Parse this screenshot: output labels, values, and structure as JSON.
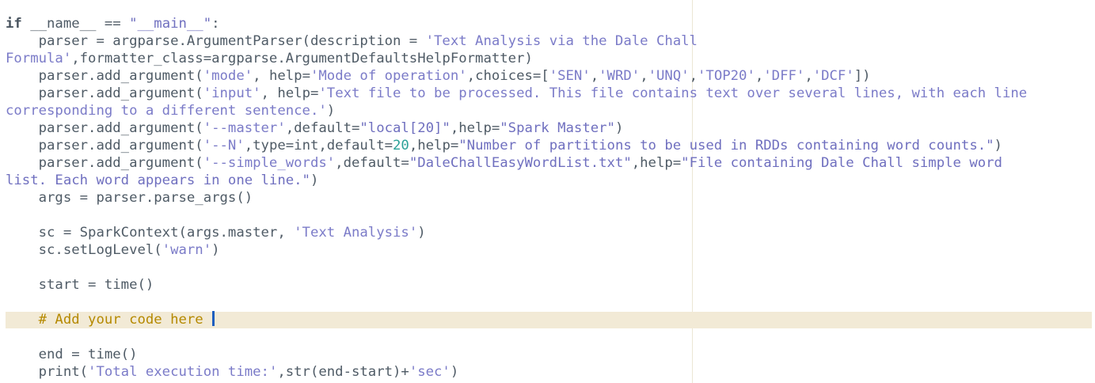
{
  "editor": {
    "lines": [
      [
        {
          "t": "if",
          "c": "kw"
        },
        {
          "t": " __name__ == ",
          "c": ""
        },
        {
          "t": "\"__main__\"",
          "c": "dstr"
        },
        {
          "t": ":",
          "c": ""
        }
      ],
      [
        {
          "t": "    parser = argparse.ArgumentParser(description = ",
          "c": ""
        },
        {
          "t": "'Text Analysis via the Dale Chall",
          "c": "str"
        }
      ],
      [
        {
          "t": "Formula'",
          "c": "str"
        },
        {
          "t": ",formatter_class=argparse.ArgumentDefaultsHelpFormatter)",
          "c": ""
        }
      ],
      [
        {
          "t": "    parser.add_argument(",
          "c": ""
        },
        {
          "t": "'mode'",
          "c": "str"
        },
        {
          "t": ", help=",
          "c": ""
        },
        {
          "t": "'Mode of operation'",
          "c": "str"
        },
        {
          "t": ",choices=[",
          "c": ""
        },
        {
          "t": "'SEN'",
          "c": "str"
        },
        {
          "t": ",",
          "c": ""
        },
        {
          "t": "'WRD'",
          "c": "str"
        },
        {
          "t": ",",
          "c": ""
        },
        {
          "t": "'UNQ'",
          "c": "str"
        },
        {
          "t": ",",
          "c": ""
        },
        {
          "t": "'TOP20'",
          "c": "str"
        },
        {
          "t": ",",
          "c": ""
        },
        {
          "t": "'DFF'",
          "c": "str"
        },
        {
          "t": ",",
          "c": ""
        },
        {
          "t": "'DCF'",
          "c": "str"
        },
        {
          "t": "])",
          "c": ""
        }
      ],
      [
        {
          "t": "    parser.add_argument(",
          "c": ""
        },
        {
          "t": "'input'",
          "c": "str"
        },
        {
          "t": ", help=",
          "c": ""
        },
        {
          "t": "'Text file to be processed. This file contains text over several lines, with each line",
          "c": "str"
        }
      ],
      [
        {
          "t": "corresponding to a different sentence.'",
          "c": "str"
        },
        {
          "t": ")",
          "c": ""
        }
      ],
      [
        {
          "t": "    parser.add_argument(",
          "c": ""
        },
        {
          "t": "'--master'",
          "c": "str"
        },
        {
          "t": ",default=",
          "c": ""
        },
        {
          "t": "\"local[20]\"",
          "c": "dstr"
        },
        {
          "t": ",help=",
          "c": ""
        },
        {
          "t": "\"Spark Master\"",
          "c": "dstr"
        },
        {
          "t": ")",
          "c": ""
        }
      ],
      [
        {
          "t": "    parser.add_argument(",
          "c": ""
        },
        {
          "t": "'--N'",
          "c": "str"
        },
        {
          "t": ",type=int,default=",
          "c": ""
        },
        {
          "t": "20",
          "c": "num"
        },
        {
          "t": ",help=",
          "c": ""
        },
        {
          "t": "\"Number of partitions to be used in RDDs containing word counts.\"",
          "c": "dstr"
        },
        {
          "t": ")",
          "c": ""
        }
      ],
      [
        {
          "t": "    parser.add_argument(",
          "c": ""
        },
        {
          "t": "'--simple_words'",
          "c": "str"
        },
        {
          "t": ",default=",
          "c": ""
        },
        {
          "t": "\"DaleChallEasyWordList.txt\"",
          "c": "dstr"
        },
        {
          "t": ",help=",
          "c": ""
        },
        {
          "t": "\"File containing Dale Chall simple word",
          "c": "dstr"
        }
      ],
      [
        {
          "t": "list. Each word appears in one line.\"",
          "c": "dstr"
        },
        {
          "t": ")",
          "c": ""
        }
      ],
      [
        {
          "t": "    args = parser.parse_args()",
          "c": ""
        }
      ],
      [],
      [
        {
          "t": "    sc = SparkContext(args.master, ",
          "c": ""
        },
        {
          "t": "'Text Analysis'",
          "c": "str"
        },
        {
          "t": ")",
          "c": ""
        }
      ],
      [
        {
          "t": "    sc.setLogLevel(",
          "c": ""
        },
        {
          "t": "'warn'",
          "c": "str"
        },
        {
          "t": ")",
          "c": ""
        }
      ],
      [],
      [
        {
          "t": "    start = time()",
          "c": ""
        }
      ],
      [],
      [
        {
          "t": "    ",
          "c": ""
        },
        {
          "t": "# Add your code here ",
          "c": "cmt"
        },
        {
          "t": "",
          "c": "caret"
        }
      ],
      [],
      [
        {
          "t": "    end = time()",
          "c": ""
        }
      ],
      [
        {
          "t": "    print(",
          "c": ""
        },
        {
          "t": "'Total execution time:'",
          "c": "str"
        },
        {
          "t": ",str(end-start)+",
          "c": ""
        },
        {
          "t": "'sec'",
          "c": "str"
        },
        {
          "t": ")",
          "c": ""
        }
      ]
    ],
    "colors": {
      "background": "#ffffff",
      "current_line": "#f2ead6",
      "margin_guide": "#ece6d4",
      "default_text": "#4f5b66",
      "string": "#7b7bc8",
      "number": "#2aa198",
      "comment": "#b58900",
      "caret": "#1f5fbf"
    }
  }
}
